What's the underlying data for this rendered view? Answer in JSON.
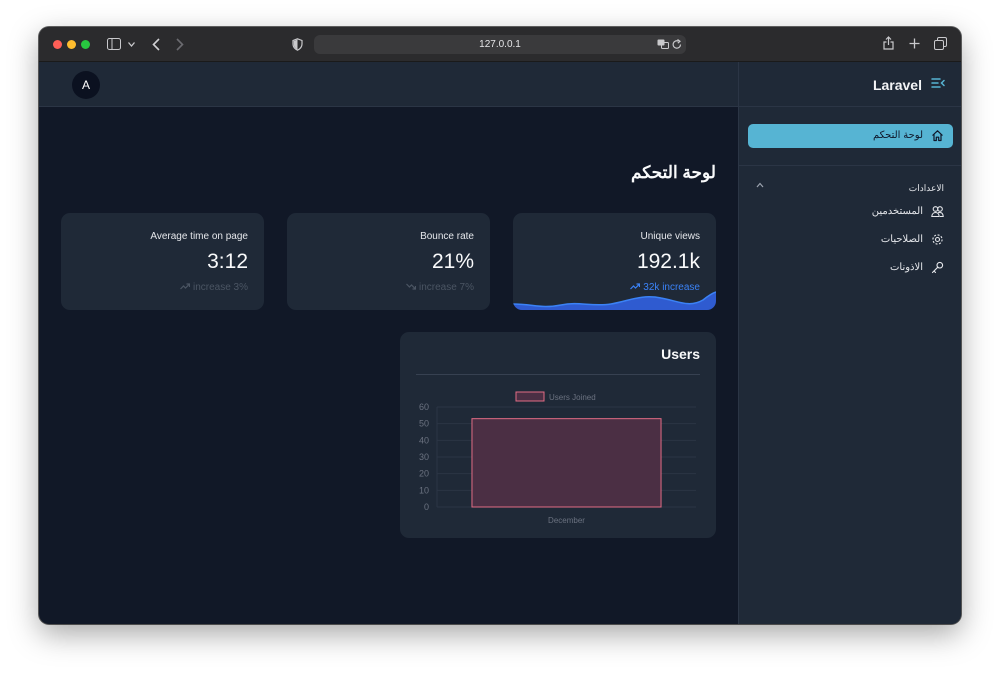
{
  "browser": {
    "url": "127.0.0.1"
  },
  "header": {
    "avatar_initial": "A"
  },
  "sidebar": {
    "brand": "Laravel",
    "active_item": {
      "label": "لوحة التحكم",
      "icon": "home-icon"
    },
    "group": {
      "title": "الاعدادات",
      "items": [
        {
          "label": "المستخدمين",
          "icon": "users-icon"
        },
        {
          "label": "الصلاحيات",
          "icon": "gear-icon"
        },
        {
          "label": "الاذونات",
          "icon": "key-icon"
        }
      ]
    }
  },
  "main": {
    "page_title": "لوحة التحكم",
    "stats": [
      {
        "label": "Unique views",
        "value": "192.1k",
        "delta": "32k increase",
        "trend": "up"
      },
      {
        "label": "Bounce rate",
        "value": "21%",
        "delta": "increase 7%",
        "trend": "down"
      },
      {
        "label": "Average time on page",
        "value": "3:12",
        "delta": "increase 3%",
        "trend": "up"
      }
    ],
    "users_card": {
      "title": "Users"
    }
  },
  "colors": {
    "accent": "#56b4d3",
    "bar_fill": "#4b2f44",
    "bar_stroke": "#e26c85",
    "sparkline": "#3b82f6"
  },
  "chart_data": {
    "type": "bar",
    "categories": [
      "December"
    ],
    "series": [
      {
        "name": "Users Joined",
        "values": [
          53
        ]
      }
    ],
    "xlabel": "",
    "ylabel": "",
    "ylim": [
      0,
      60
    ],
    "yticks": [
      0,
      10,
      20,
      30,
      40,
      50,
      60
    ],
    "grid": true,
    "legend": "top"
  }
}
